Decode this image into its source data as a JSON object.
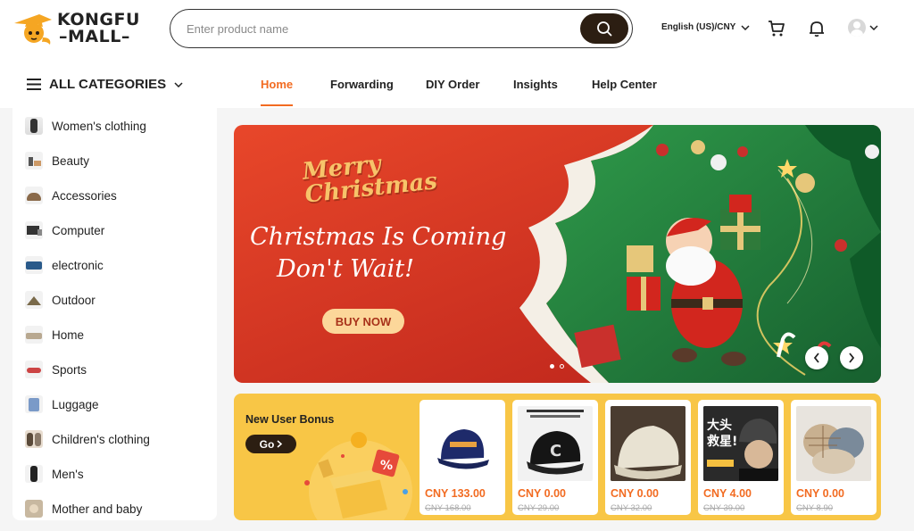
{
  "brand": {
    "line1": "KONGFU",
    "line2": "MALL"
  },
  "search": {
    "placeholder": "Enter product name"
  },
  "header": {
    "language": "English (US)/CNY"
  },
  "nav": {
    "all_categories": "ALL CATEGORIES",
    "tabs": [
      {
        "label": "Home",
        "active": true
      },
      {
        "label": "Forwarding"
      },
      {
        "label": "DIY Order"
      },
      {
        "label": "Insights"
      },
      {
        "label": "Help Center"
      }
    ]
  },
  "categories": [
    {
      "label": "Women's clothing"
    },
    {
      "label": "Beauty"
    },
    {
      "label": "Accessories"
    },
    {
      "label": "Computer"
    },
    {
      "label": "electronic"
    },
    {
      "label": "Outdoor"
    },
    {
      "label": "Home"
    },
    {
      "label": "Sports"
    },
    {
      "label": "Luggage"
    },
    {
      "label": "Children's clothing"
    },
    {
      "label": "Men's"
    },
    {
      "label": "Mother and baby"
    }
  ],
  "banner": {
    "merry1": "Merry",
    "merry2": "Christmas",
    "line1": "Christmas Is Coming",
    "line2": "Don't Wait!",
    "button": "BUY NOW"
  },
  "bonus": {
    "title": "New User Bonus",
    "go": "Go",
    "products": [
      {
        "price": "CNY 133.00",
        "old_price": "CNY 168.00"
      },
      {
        "price": "CNY 0.00",
        "old_price": "CNY 29.00"
      },
      {
        "price": "CNY 0.00",
        "old_price": "CNY 32.00"
      },
      {
        "price": "CNY 4.00",
        "old_price": "CNY 39.00"
      },
      {
        "price": "CNY 0.00",
        "old_price": "CNY 8.90"
      }
    ]
  },
  "colors": {
    "accent": "#f26b21",
    "dark": "#2c1e12",
    "bonus_bg": "#f8c646",
    "banner_red": "#d9341d",
    "banner_green": "#1f7a3a"
  }
}
